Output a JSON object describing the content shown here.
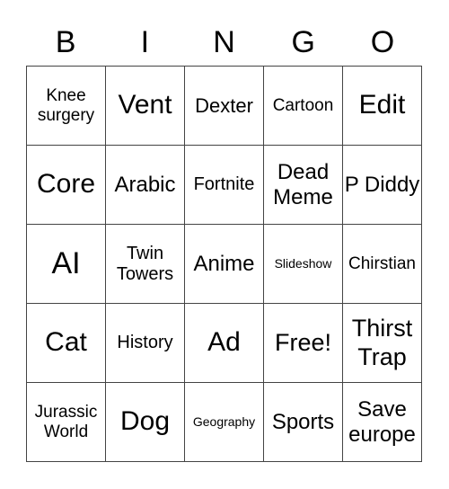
{
  "header": {
    "letters": [
      "B",
      "I",
      "N",
      "G",
      "O"
    ]
  },
  "grid": {
    "rows": [
      [
        "Knee surgery",
        "Vent",
        "Dexter",
        "Cartoon",
        "Edit"
      ],
      [
        "Core",
        "Arabic",
        "Fortnite",
        "Dead Meme",
        "P Diddy"
      ],
      [
        "AI",
        "Twin Towers",
        "Anime",
        "Slideshow",
        "Chirstian"
      ],
      [
        "Cat",
        "History",
        "Ad",
        "Free!",
        "Thirst Trap"
      ],
      [
        "Jurassic World",
        "Dog",
        "Geography",
        "Sports",
        "Save europe"
      ]
    ]
  },
  "colors": {
    "line": "#444444",
    "text": "#000000",
    "background": "#ffffff"
  }
}
